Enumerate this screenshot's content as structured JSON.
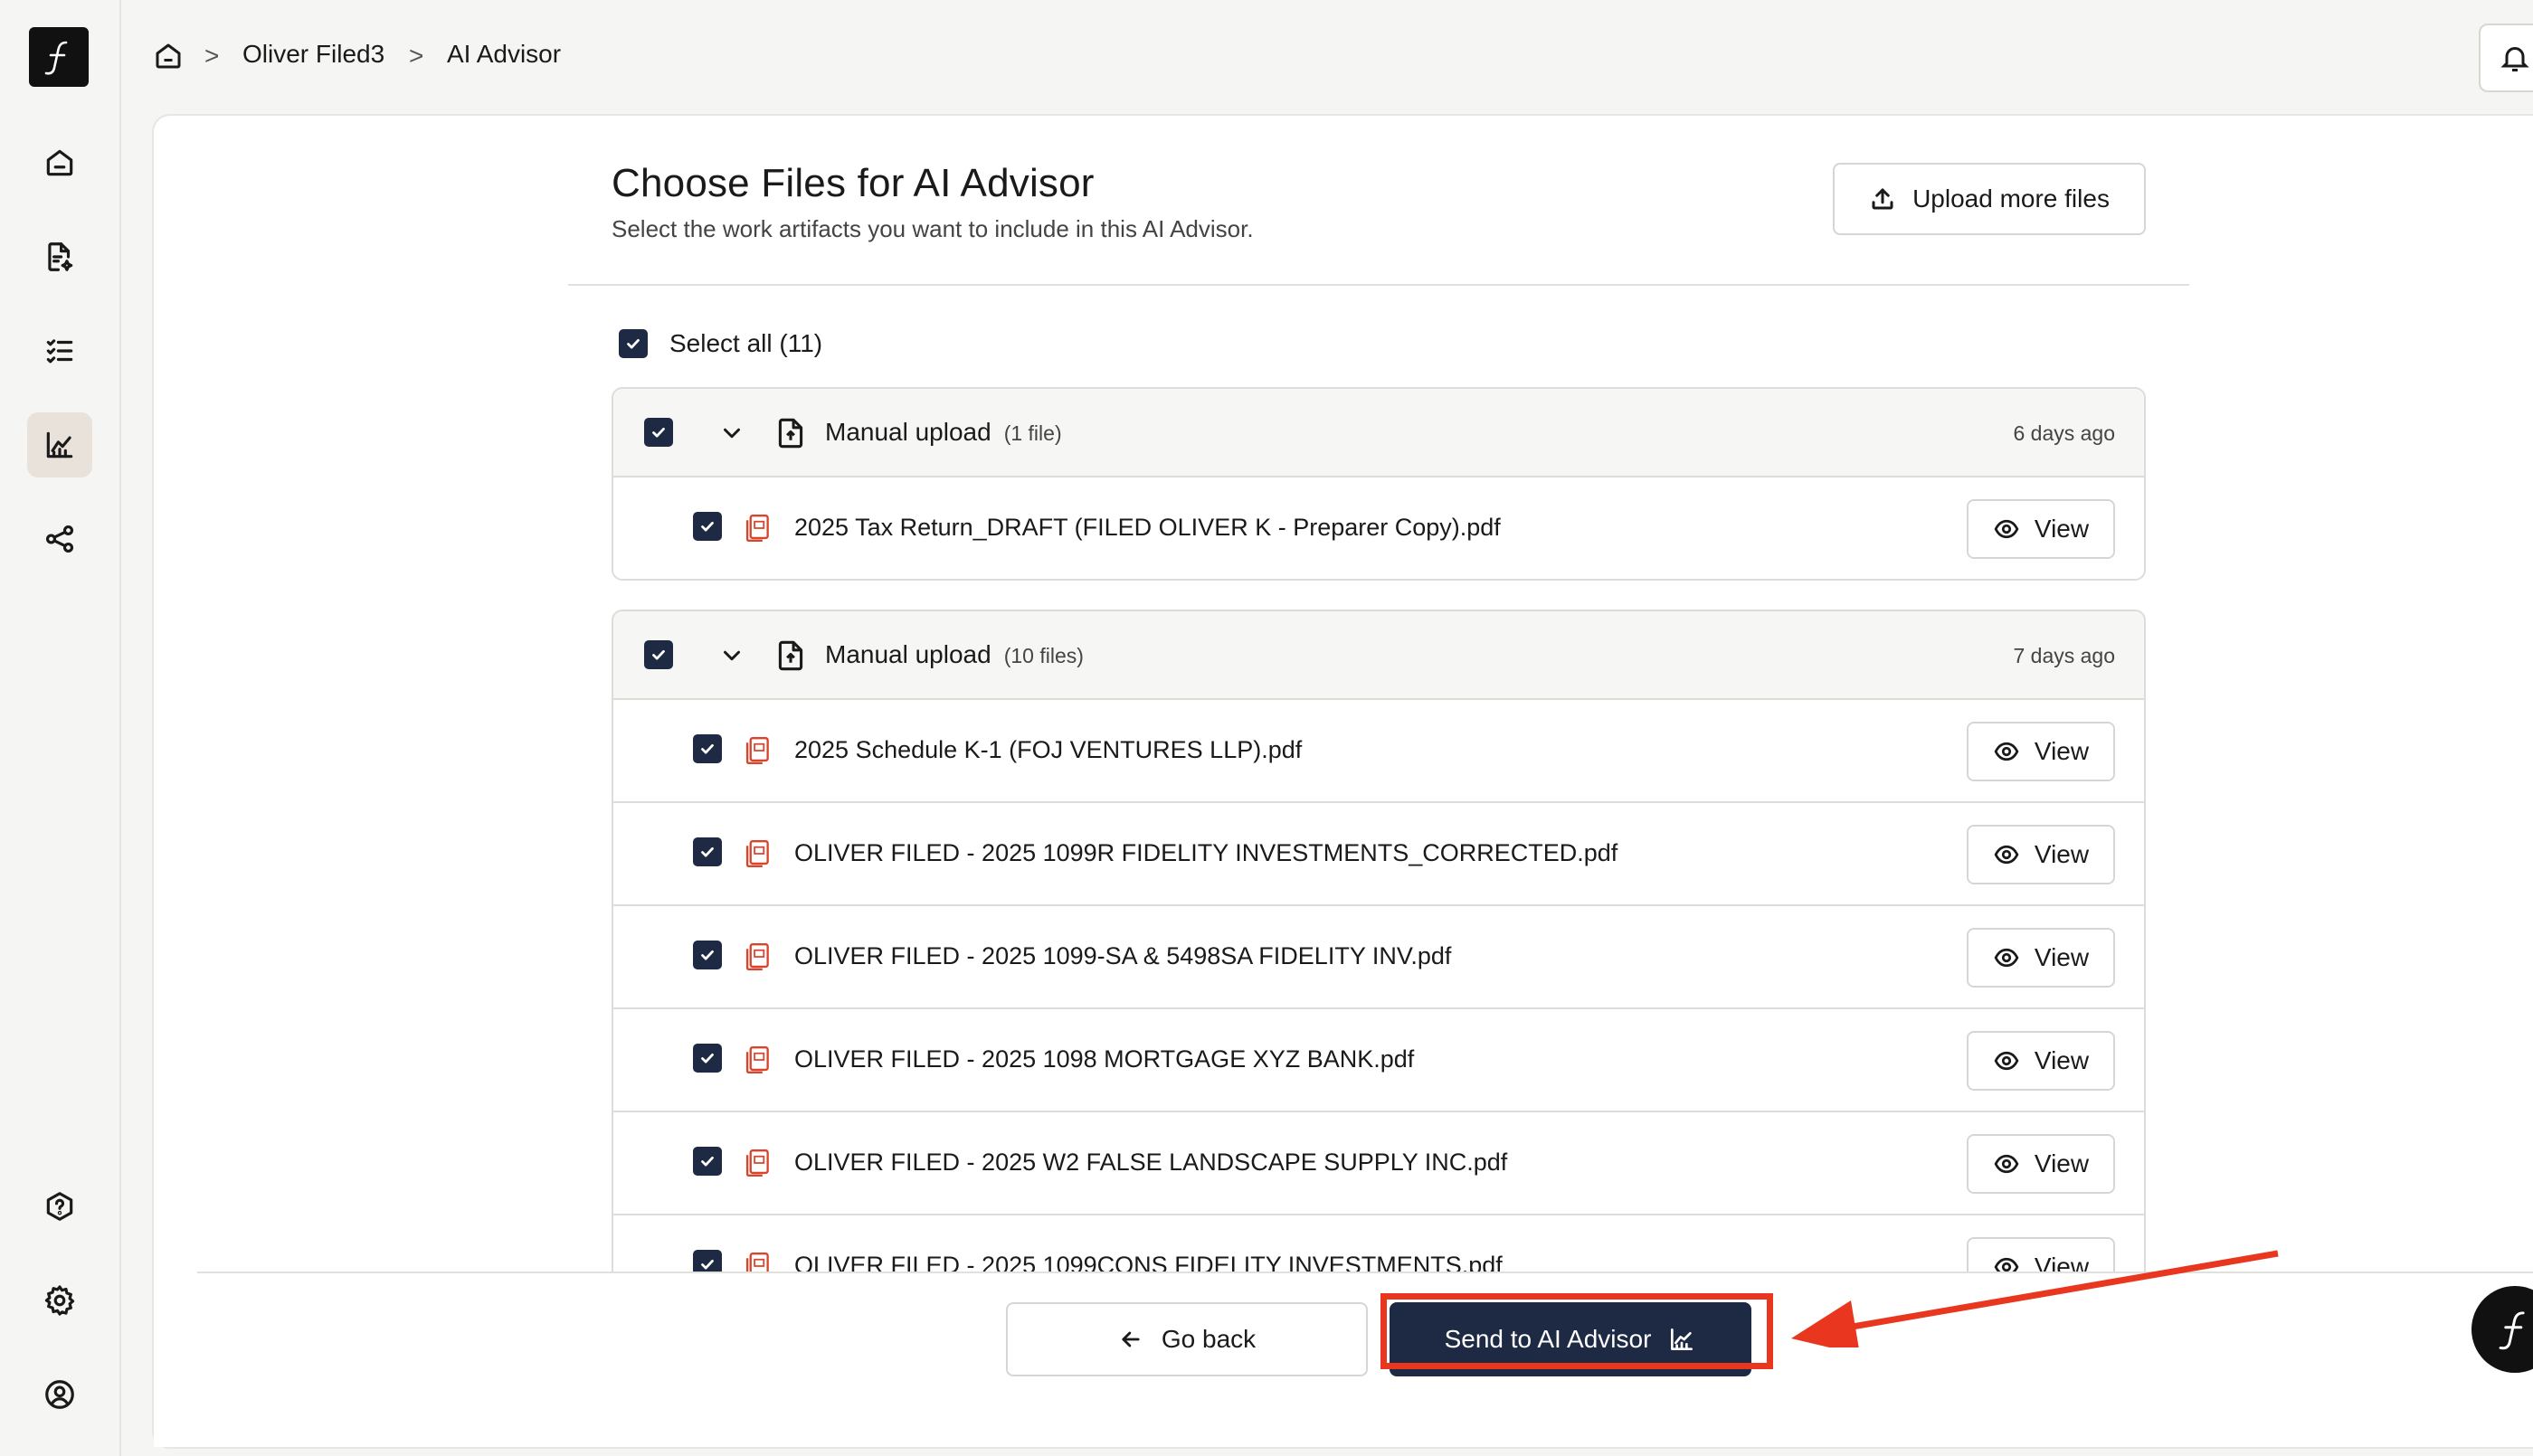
{
  "breadcrumb": {
    "items": [
      "Oliver Filed3",
      "AI Advisor"
    ],
    "separator": ">"
  },
  "header": {
    "title": "Choose Files for AI Advisor",
    "subtitle": "Select the work artifacts you want to include in this AI Advisor.",
    "upload_label": "Upload more files"
  },
  "select_all": {
    "label": "Select all (11)",
    "checked": true
  },
  "groups": [
    {
      "label": "Manual upload",
      "count": "(1 file)",
      "date": "6 days ago",
      "files": [
        {
          "name": "2025 Tax Return_DRAFT (FILED OLIVER K - Preparer Copy).pdf"
        }
      ]
    },
    {
      "label": "Manual upload",
      "count": "(10 files)",
      "date": "7 days ago",
      "files": [
        {
          "name": "2025 Schedule K-1 (FOJ VENTURES LLP).pdf"
        },
        {
          "name": "OLIVER FILED - 2025 1099R FIDELITY INVESTMENTS_CORRECTED.pdf"
        },
        {
          "name": "OLIVER FILED - 2025 1099-SA & 5498SA FIDELITY INV.pdf"
        },
        {
          "name": "OLIVER FILED - 2025 1098 MORTGAGE XYZ BANK.pdf"
        },
        {
          "name": "OLIVER FILED - 2025 W2 FALSE LANDSCAPE SUPPLY INC.pdf"
        },
        {
          "name": "OLIVER FILED - 2025 1099CONS FIDELITY INVESTMENTS.pdf"
        }
      ]
    }
  ],
  "row_action_label": "View",
  "footer": {
    "back_label": "Go back",
    "send_label": "Send to AI Advisor"
  },
  "colors": {
    "primary": "#1e2a44",
    "annotation": "#e8361f",
    "pdf_icon": "#d9442b"
  }
}
